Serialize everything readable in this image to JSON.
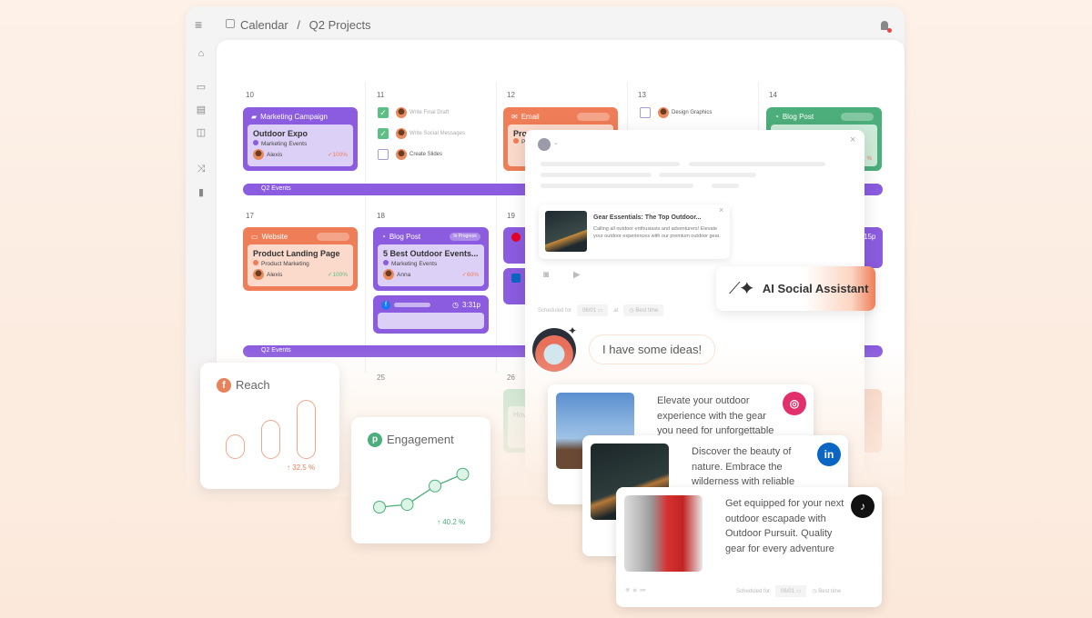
{
  "header": {
    "breadcrumb_root": "Calendar",
    "separator": "/",
    "breadcrumb_current": "Q2 Projects"
  },
  "sidebar": {
    "items": [
      "home-icon",
      "calendar-icon",
      "layout-icon",
      "columns-icon",
      "shuffle-icon",
      "chart-icon"
    ]
  },
  "calendar": {
    "days_row1": [
      "10",
      "11",
      "12",
      "13",
      "14"
    ],
    "days_row2": [
      "17",
      "18",
      "19"
    ],
    "days_row3": [
      "25",
      "26"
    ],
    "event_bar": "Q2 Events",
    "marketing_card": {
      "type": "Marketing Campaign",
      "title": "Outdoor Expo",
      "tag": "Marketing Events",
      "assignee": "Alexis",
      "progress": "100%"
    },
    "tasks_11": [
      {
        "label": "Write Final Draft",
        "done": true
      },
      {
        "label": "Write Social Messages",
        "done": true
      },
      {
        "label": "Create Slides",
        "done": false
      }
    ],
    "email_card": {
      "type": "Email",
      "title": "Prod",
      "tag": "Pr"
    },
    "tasks_13": [
      {
        "label": "Design Graphics",
        "done": false
      }
    ],
    "blog_card_14": {
      "type": "Blog Post",
      "progress": "%"
    },
    "website_card": {
      "type": "Website",
      "title": "Product Landing Page",
      "tag": "Product Marketing",
      "assignee": "Alexis",
      "progress": "100%"
    },
    "blog_card_18": {
      "type": "Blog Post",
      "status": "In Progress",
      "title": "5 Best Outdoor Events...",
      "tag": "Marketing Events",
      "assignee": "Anna",
      "progress": "60%"
    },
    "fb_card": {
      "time": "3:31p"
    },
    "right_time": "15p",
    "blog_card_26": {
      "title": "Hov"
    }
  },
  "composer": {
    "preview_title": "Gear Essentials: The Top Outdoor...",
    "preview_body": "Calling all outdoor enthusiasts and adventurers! Elevate your outdoor experiences with our premium outdoor gear.",
    "scheduled_label": "Scheduled for",
    "date": "06/01",
    "at": "at",
    "best_time": "Best time",
    "assistant_label": "AI Social Assistant",
    "assistant_message": "I have some ideas!"
  },
  "posts": [
    {
      "network": "instagram",
      "text": "Elevate your outdoor experience with the gear you need for unforgettable",
      "color": "#e1306c"
    },
    {
      "network": "linkedin",
      "text": "Discover the beauty of nature. Embrace the wilderness with reliable gear.",
      "color": "#0a66c2"
    },
    {
      "network": "tiktok",
      "text": "Get equipped for your next outdoor escapade with Outdoor Pursuit. Quality gear for every adventure",
      "color": "#111111",
      "scheduled_label": "Scheduled for",
      "date": "06/01",
      "best_time": "Best time"
    }
  ],
  "widgets": {
    "reach": {
      "title": "Reach",
      "network": "facebook",
      "change": "32.5 %",
      "bars": [
        1,
        1.6,
        2.4
      ],
      "color": "#e8825b"
    },
    "engagement": {
      "title": "Engagement",
      "network": "pinterest",
      "change": "40.2 %",
      "points": [
        1,
        1.2,
        2.6,
        3.5
      ],
      "color": "#4cae7a"
    }
  },
  "colors": {
    "purple": "#8b5cdf",
    "orange": "#ef7d57",
    "green": "#4cae7a"
  }
}
